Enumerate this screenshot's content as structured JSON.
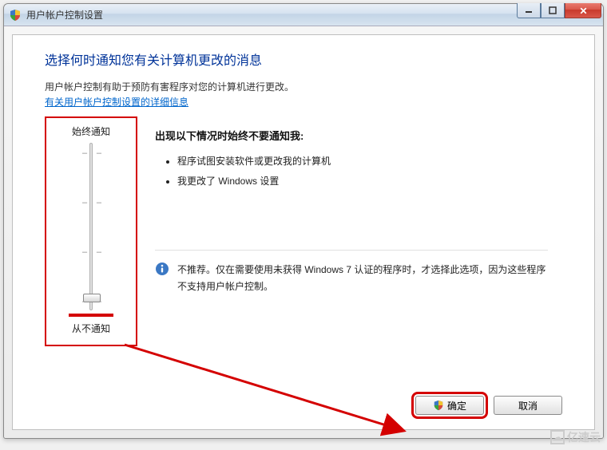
{
  "window": {
    "title": "用户帐户控制设置"
  },
  "heading": "选择何时通知您有关计算机更改的消息",
  "description": "用户帐户控制有助于预防有害程序对您的计算机进行更改。",
  "link_text": "有关用户帐户控制设置的详细信息",
  "slider": {
    "top_label": "始终通知",
    "bottom_label": "从不通知",
    "levels": 4,
    "current_level": 0
  },
  "right": {
    "title": "出现以下情况时始终不要通知我:",
    "bullets": [
      "程序试图安装软件或更改我的计算机",
      "我更改了 Windows 设置"
    ],
    "info": "不推荐。仅在需要使用未获得 Windows 7 认证的程序时，才选择此选项，因为这些程序不支持用户帐户控制。"
  },
  "buttons": {
    "ok": "确定",
    "cancel": "取消"
  },
  "watermark": "亿速云"
}
